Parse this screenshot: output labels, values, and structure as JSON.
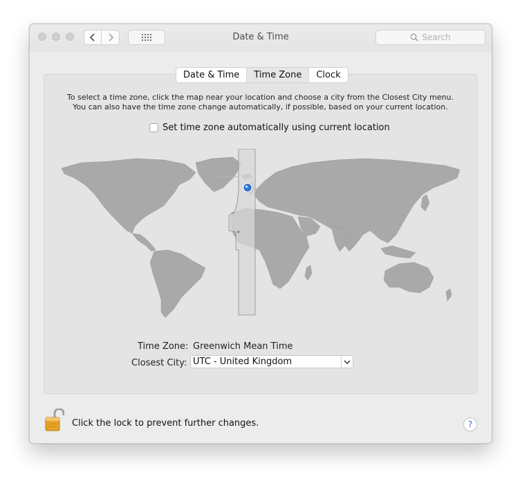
{
  "window": {
    "title": "Date & Time"
  },
  "search": {
    "placeholder": "Search"
  },
  "tabs": [
    {
      "label": "Date & Time",
      "active": false
    },
    {
      "label": "Time Zone",
      "active": true
    },
    {
      "label": "Clock",
      "active": false
    }
  ],
  "instructions": {
    "line1": "To select a time zone, click the map near your location and choose a city from the Closest City menu.",
    "line2": "You can also have the time zone change automatically, if possible, based on your current location."
  },
  "auto_timezone": {
    "label": "Set time zone automatically using current location",
    "checked": false
  },
  "timezone": {
    "label": "Time Zone:",
    "value": "Greenwich Mean Time"
  },
  "closest_city": {
    "label": "Closest City:",
    "value": "UTC - United Kingdom"
  },
  "lock": {
    "label": "Click the lock to prevent further changes.",
    "state": "unlocked"
  },
  "help": {
    "glyph": "?"
  },
  "icons": [
    "back-chevron-icon",
    "forward-chevron-icon",
    "grid-icon",
    "search-icon",
    "location-pin-icon",
    "chevron-down-icon",
    "padlock-icon"
  ],
  "colors": {
    "accent": "#2f7de1",
    "land": "#a9a9a9",
    "zone_band": "#d8d8d8"
  }
}
